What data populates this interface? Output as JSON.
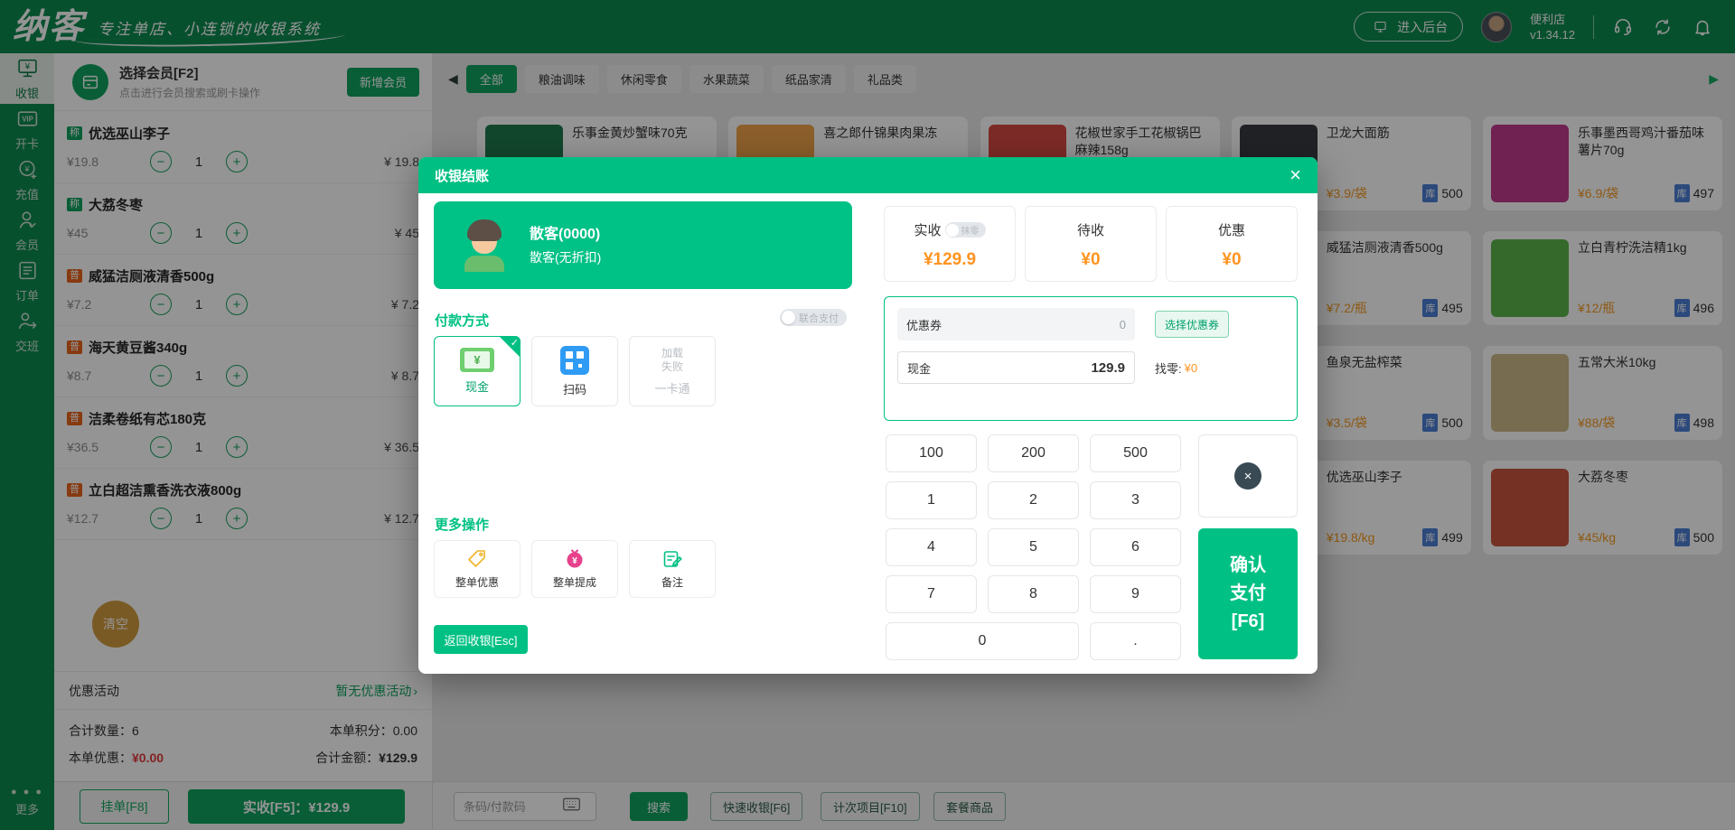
{
  "colors": {
    "brand_green": "#0d8a50",
    "accent_green": "#10a35f",
    "modal_green": "#00c186",
    "price_orange": "#ff9421",
    "stock_blue": "#4d7fd6",
    "badge_weigh_green": "#10a35f",
    "badge_normal_orange": "#e8641d",
    "danger_red": "#e23b3b",
    "clear_gold": "#d29b3f"
  },
  "icons": {
    "close": "×",
    "check": "✓",
    "minus": "−",
    "plus": "+",
    "prev": "◀",
    "next": "▶",
    "chevron": "›",
    "more_dots": "● ● ●",
    "backspace": "×"
  },
  "topbar": {
    "logo": "纳客",
    "tagline": "专注单店、小连锁的收银系统",
    "backend_button": "进入后台",
    "store_name": "便利店",
    "version": "v1.34.12"
  },
  "sidebar": {
    "items": [
      {
        "label": "收银"
      },
      {
        "label": "开卡"
      },
      {
        "label": "充值"
      },
      {
        "label": "会员"
      },
      {
        "label": "订单"
      },
      {
        "label": "交班"
      }
    ],
    "more_label": "更多"
  },
  "member_bar": {
    "title": "选择会员[F2]",
    "subtitle": "点击进行会员搜索或刷卡操作",
    "add_button": "新增会员"
  },
  "cart": {
    "items": [
      {
        "badge": "称",
        "name": "优选巫山李子",
        "price": "¥19.8",
        "qty": "1",
        "total": "¥ 19.8"
      },
      {
        "badge": "称",
        "name": "大荔冬枣",
        "price": "¥45",
        "qty": "1",
        "total": "¥ 45"
      },
      {
        "badge": "普",
        "name": "威猛洁厕液清香500g",
        "price": "¥7.2",
        "qty": "1",
        "total": "¥ 7.2"
      },
      {
        "badge": "普",
        "name": "海天黄豆酱340g",
        "price": "¥8.7",
        "qty": "1",
        "total": "¥ 8.7"
      },
      {
        "badge": "普",
        "name": "洁柔卷纸有芯180克",
        "price": "¥36.5",
        "qty": "1",
        "total": "¥ 36.5"
      },
      {
        "badge": "普",
        "name": "立白超洁熏香洗衣液800g",
        "price": "¥12.7",
        "qty": "1",
        "total": "¥ 12.7"
      }
    ],
    "clear_button": "清空"
  },
  "promo": {
    "label": "优惠活动",
    "value": "暂无优惠活动"
  },
  "summary": {
    "qty_label": "合计数量：",
    "qty": "6",
    "points_label": "本单积分：",
    "points": "0.00",
    "discount_label": "本单优惠：",
    "discount": "¥0.00",
    "total_label": "合计金额：",
    "total": "¥129.9"
  },
  "bottombar": {
    "hold_button": "挂单[F8]",
    "charge_button": "实收[F5]：¥129.9",
    "barcode_placeholder": "条码/付款码",
    "search_button": "搜索",
    "quick_button": "快速收银[F6]",
    "count_button": "计次项目[F10]",
    "combo_button": "套餐商品"
  },
  "categories": [
    "全部",
    "粮油调味",
    "休闲零食",
    "水果蔬菜",
    "纸品家清",
    "礼品类"
  ],
  "labels": {
    "stock_badge": "库"
  },
  "products": {
    "r1c1": {
      "name": "乐事金黄炒蟹味70克",
      "img": "#1f7a4e"
    },
    "r1c2": {
      "name": "喜之郎什锦果肉果冻",
      "img": "#f2a44b"
    },
    "r1c3": {
      "name": "花椒世家手工花椒锅巴麻辣158g",
      "img": "#d84a44"
    },
    "r1c4": {
      "name": "卫龙大面筋",
      "price": "¥3.9/袋",
      "stock": "500",
      "img": "#3a3b40"
    },
    "r1c5": {
      "name": "乐事墨西哥鸡汁番茄味薯片70g",
      "price": "¥6.9/袋",
      "stock": "497",
      "img": "#c23b8e"
    },
    "r2c4": {
      "name": "威猛洁厕液清香500g",
      "price": "¥7.2/瓶",
      "stock": "495",
      "img": "#77c14f"
    },
    "r2c5": {
      "name": "立白青柠洗洁精1kg",
      "price": "¥12/瓶",
      "stock": "496",
      "img": "#5cb54a"
    },
    "r3c4": {
      "name": "鱼泉无盐榨菜",
      "price": "¥3.5/袋",
      "stock": "500",
      "img": "#dfe3d8"
    },
    "r3c5": {
      "name": "五常大米10kg",
      "price": "¥88/袋",
      "stock": "498",
      "img": "#cdb98a"
    },
    "r4c4": {
      "name": "优选巫山李子",
      "price": "¥19.8/kg",
      "stock": "499",
      "img": "#e0b34c"
    },
    "r4c5": {
      "name": "大荔冬枣",
      "price": "¥45/kg",
      "stock": "500",
      "img": "#c9553e"
    }
  },
  "modal": {
    "title": "收银结账",
    "member": {
      "name": "散客(0000)",
      "desc": "散客(无折扣)"
    },
    "pay_section": "付款方式",
    "union_toggle": "联合支付",
    "methods": [
      {
        "label": "现金"
      },
      {
        "label": "扫码"
      },
      {
        "label": "一卡通",
        "error": "加载失败"
      }
    ],
    "more_section": "更多操作",
    "actions": [
      {
        "label": "整单优惠"
      },
      {
        "label": "整单提成"
      },
      {
        "label": "备注"
      }
    ],
    "back_button": "返回收银[Esc]",
    "stats": [
      {
        "label": "实收",
        "value": "¥129.9",
        "toggle": "抹零"
      },
      {
        "label": "待收",
        "value": "¥0"
      },
      {
        "label": "优惠",
        "value": "¥0"
      }
    ],
    "coupon": {
      "label": "优惠券",
      "count": "0",
      "select_button": "选择优惠券"
    },
    "cash_row": {
      "label": "现金",
      "value": "129.9",
      "change_label": "找零:",
      "change_value": "¥0"
    },
    "numpad": [
      "100",
      "200",
      "500",
      "1",
      "2",
      "3",
      "4",
      "5",
      "6",
      "7",
      "8",
      "9",
      "0",
      "."
    ],
    "confirm_button": "确认支付[F6]"
  }
}
